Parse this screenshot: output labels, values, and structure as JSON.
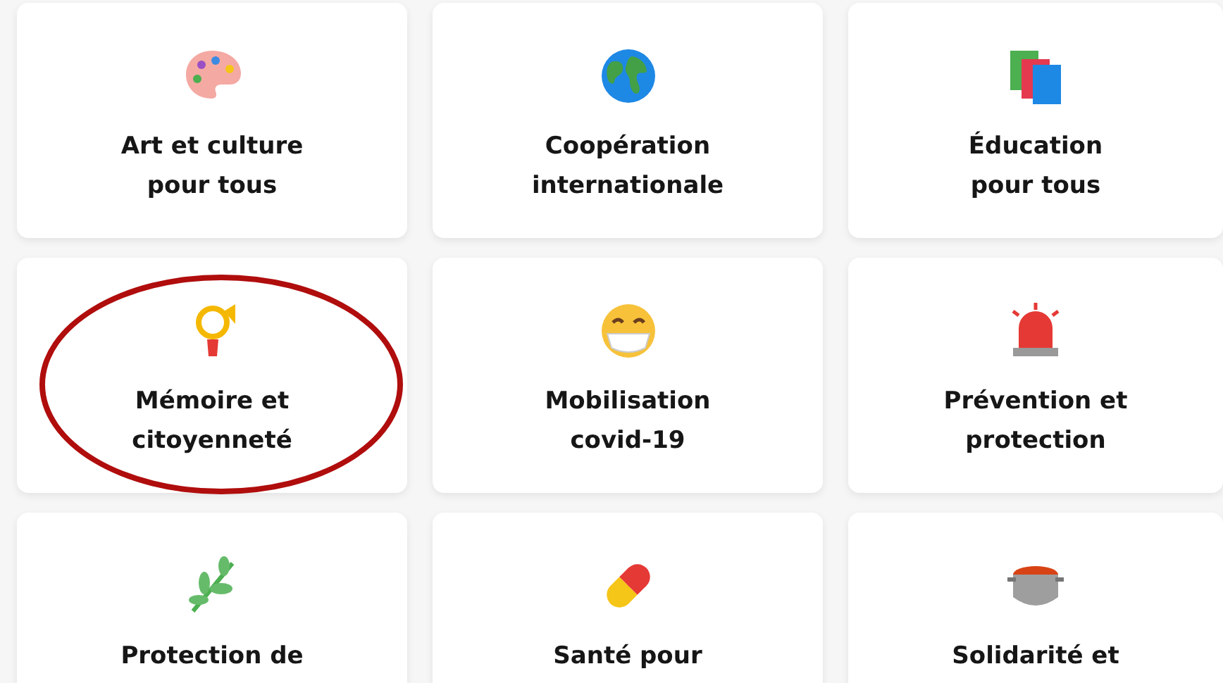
{
  "cards": [
    {
      "kind": "palette",
      "lines": [
        "Art et culture",
        "pour tous"
      ],
      "circled": false
    },
    {
      "kind": "globe",
      "lines": [
        "Coopération",
        "internationale"
      ],
      "circled": false
    },
    {
      "kind": "books",
      "lines": [
        "Éducation",
        "pour tous"
      ],
      "circled": false
    },
    {
      "kind": "horn",
      "lines": [
        "Mémoire et",
        "citoyenneté"
      ],
      "circled": true
    },
    {
      "kind": "mask",
      "lines": [
        "Mobilisation",
        "covid-19"
      ],
      "circled": false
    },
    {
      "kind": "siren",
      "lines": [
        "Prévention et",
        "protection"
      ],
      "circled": false
    },
    {
      "kind": "leaf",
      "lines": [
        "Protection de"
      ],
      "circled": false
    },
    {
      "kind": "pill",
      "lines": [
        "Santé pour"
      ],
      "circled": false
    },
    {
      "kind": "pot",
      "lines": [
        "Solidarité et"
      ],
      "circled": false
    }
  ]
}
